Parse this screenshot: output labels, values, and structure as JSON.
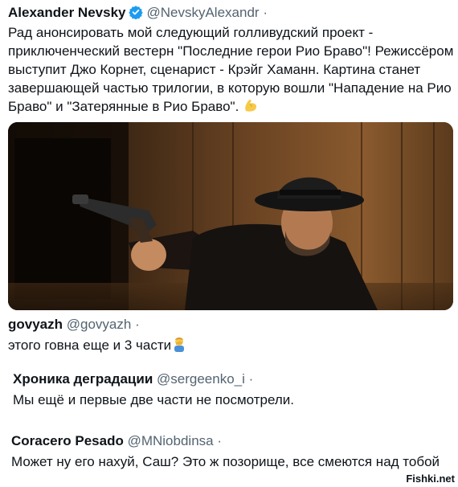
{
  "post": {
    "author_name": "Alexander Nevsky",
    "author_handle": "@NevskyAlexandr",
    "separator": "·",
    "verified_icon": "verified-badge-icon",
    "verified_color": "#1d9bf0",
    "lines": [
      "Рад анонсировать мой следующий голливудский проект -",
      "приключенческий вестерн \"Последние герои Рио Браво\"! Режиссёром",
      "выступит Джо Корнет, сценарист - Крэйг Хаманн. Картина станет",
      "завершающей частью трилогии, в которую вошли \"Нападение на Рио",
      "Браво\" и \"Затерянные в Рио Браво\"."
    ],
    "emoji": "flexed-biceps-icon"
  },
  "comments": [
    {
      "name": "govyazh",
      "handle": "@govyazh",
      "separator": "·",
      "text": "этого говна еще и 3 части",
      "emoji": "man-facepalming-icon"
    },
    {
      "name": "Хроника деградации",
      "handle": "@sergeenko_i",
      "separator": "·",
      "text": "Мы ещё и первые две части не посмотрели."
    },
    {
      "name": "Coracero Pesado",
      "handle": "@MNiobdinsa",
      "separator": "·",
      "text": "Может ну его нахуй, Саш? Это ж позорище, все смеются над тобой"
    }
  ],
  "watermark": "Fishki.net"
}
